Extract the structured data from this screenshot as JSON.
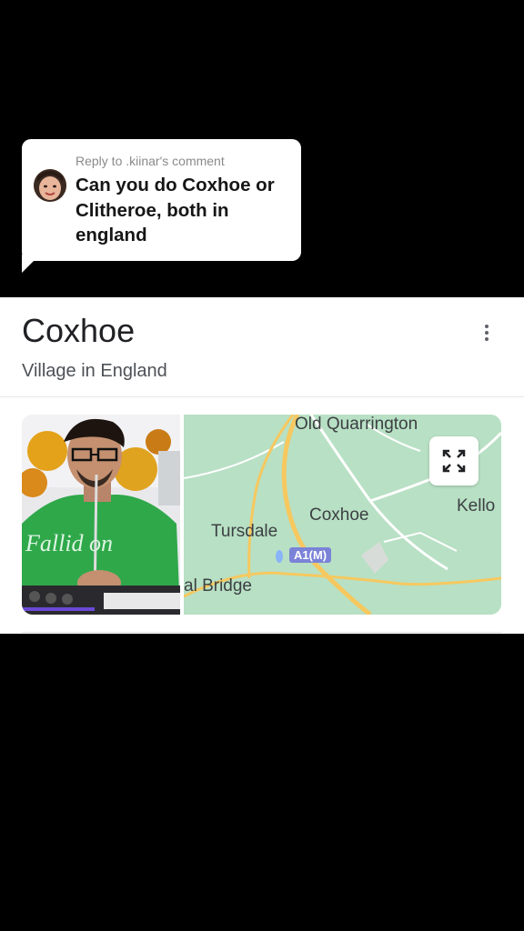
{
  "reply": {
    "header": "Reply to .kiinar's comment",
    "text": "Can you do Coxhoe or Clitheroe, both in england"
  },
  "place": {
    "title": "Coxhoe",
    "subtitle": "Village in England"
  },
  "photo": {
    "shirt_text": "Fallid on"
  },
  "map": {
    "labels": {
      "old_quarrington": "Old Quarrington",
      "coxhoe": "Coxhoe",
      "tursdale": "Tursdale",
      "kello": "Kello",
      "al_bridge": "al Bridge"
    },
    "road_badge": "A1(M)"
  },
  "colors": {
    "map_green": "#b8e0c4",
    "road_yellow": "#f6c85f",
    "badge": "#7b83d8"
  }
}
